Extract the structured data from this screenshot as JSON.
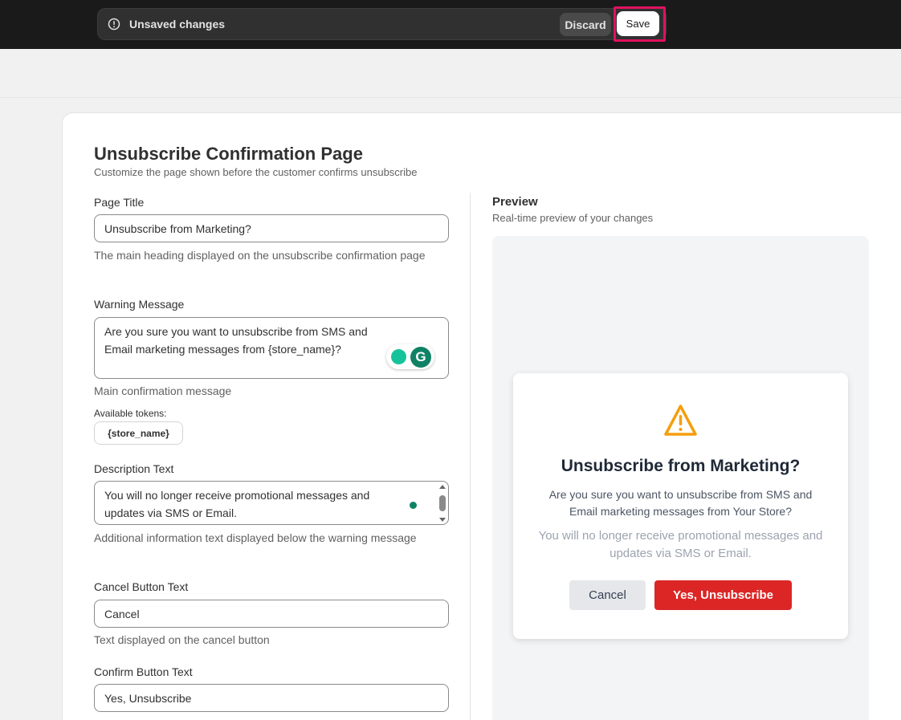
{
  "save_bar": {
    "message": "Unsaved changes",
    "discard_label": "Discard",
    "save_label": "Save",
    "highlight_color": "#e0115f"
  },
  "page": {
    "title": "Unsubscribe Confirmation Page",
    "subtitle": "Customize the page shown before the customer confirms unsubscribe"
  },
  "form": {
    "page_title": {
      "label": "Page Title",
      "value": "Unsubscribe from Marketing?",
      "help": "The main heading displayed on the unsubscribe confirmation page"
    },
    "warning_message": {
      "label": "Warning Message",
      "value": "Are you sure you want to unsubscribe from SMS and Email marketing messages from {store_name}?",
      "help": "Main confirmation message",
      "tokens_label": "Available tokens:",
      "tokens": [
        "{store_name}"
      ]
    },
    "description_text": {
      "label": "Description Text",
      "value": "You will no longer receive promotional messages and updates via SMS or Email.",
      "help": "Additional information text displayed below the warning message"
    },
    "cancel_button_text": {
      "label": "Cancel Button Text",
      "value": "Cancel",
      "help": "Text displayed on the cancel button"
    },
    "confirm_button_text": {
      "label": "Confirm Button Text",
      "value": "Yes, Unsubscribe"
    }
  },
  "preview": {
    "title": "Preview",
    "subtitle": "Real-time preview of your changes",
    "heading": "Unsubscribe from Marketing?",
    "warning": "Are you sure you want to unsubscribe from SMS and Email marketing messages from Your Store?",
    "description": "You will no longer receive promotional messages and updates via SMS or Email.",
    "cancel_label": "Cancel",
    "confirm_label": "Yes, Unsubscribe",
    "warning_icon_color": "#f59e0b",
    "confirm_color": "#dc2626"
  },
  "grammarly": {
    "logo_letter": "G"
  }
}
